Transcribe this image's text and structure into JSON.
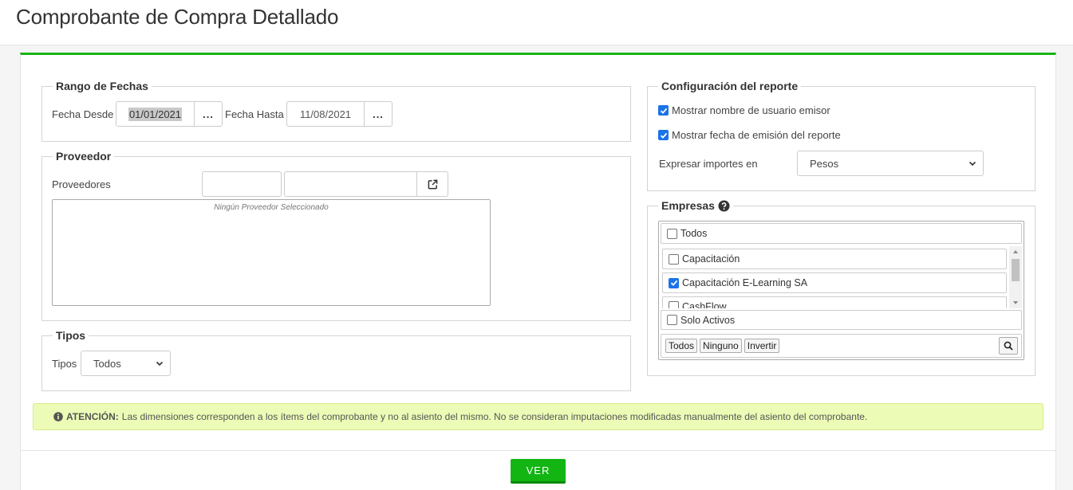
{
  "page": {
    "title": "Comprobante de Compra Detallado"
  },
  "fechas": {
    "legend": "Rango de Fechas",
    "desde_label": "Fecha Desde",
    "desde_value": "01/01/2021",
    "hasta_label": "Fecha Hasta",
    "hasta_value": "11/08/2021",
    "picker_label": "..."
  },
  "proveedor": {
    "legend": "Proveedor",
    "label": "Proveedores",
    "code_value": "",
    "name_value": "",
    "empty_text": "Ningún Proveedor Seleccionado",
    "open_icon": "external-link-icon"
  },
  "tipos": {
    "legend": "Tipos",
    "label": "Tipos",
    "selected": "Todos"
  },
  "config": {
    "legend": "Configuración del reporte",
    "opt_usuario": {
      "label": "Mostrar nombre de usuario emisor",
      "checked": true
    },
    "opt_fecha": {
      "label": "Mostrar fecha de emisión del reporte",
      "checked": true
    },
    "importes_label": "Expresar importes en",
    "importes_selected": "Pesos"
  },
  "empresas": {
    "legend": "Empresas",
    "help_icon": "question-circle-icon",
    "todos_label": "Todos",
    "items": [
      {
        "label": "Capacitación",
        "checked": false
      },
      {
        "label": "Capacitación E-Learning SA",
        "checked": true
      },
      {
        "label": "CashFlow",
        "checked": false
      }
    ],
    "solo_activos": "Solo Activos",
    "btn_todos": "Todos",
    "btn_ninguno": "Ninguno",
    "btn_invertir": "Invertir",
    "search_icon": "search-icon"
  },
  "alert": {
    "icon": "info-circle-icon",
    "title": "ATENCIÓN:",
    "text": "Las dimensiones corresponden a los ítems del comprobante y no al asiento del mismo. No se consideran imputaciones modificadas manualmente del asiento del comprobante."
  },
  "actions": {
    "ver_label": "VER"
  },
  "colors": {
    "accent": "#16b416",
    "alert_bg": "#ecfbb6",
    "checkbox": "#1a73e8"
  }
}
